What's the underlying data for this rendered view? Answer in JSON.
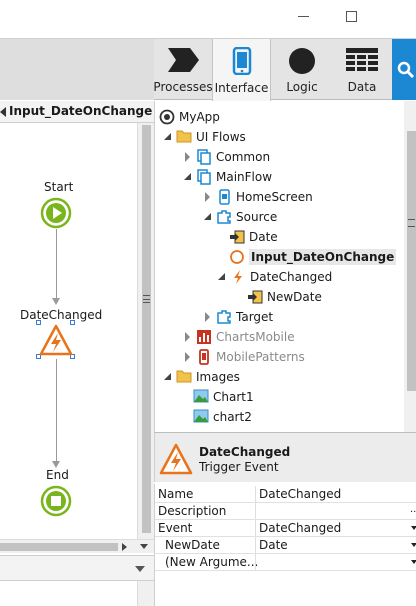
{
  "toolbar": {
    "tabs": [
      {
        "label": "Processes",
        "icon": "processes-icon"
      },
      {
        "label": "Interface",
        "icon": "interface-icon"
      },
      {
        "label": "Logic",
        "icon": "logic-icon"
      },
      {
        "label": "Data",
        "icon": "data-icon"
      }
    ],
    "search_icon": "search-icon"
  },
  "canvas": {
    "title": "Input_DateOnChange",
    "nodes": {
      "start": "Start",
      "trigger": "DateChanged",
      "end": "End"
    }
  },
  "tree": {
    "items": [
      {
        "label": "MyApp"
      },
      {
        "label": "UI Flows"
      },
      {
        "label": "Common"
      },
      {
        "label": "MainFlow"
      },
      {
        "label": "HomeScreen"
      },
      {
        "label": "Source"
      },
      {
        "label": "Date"
      },
      {
        "label": "Input_DateOnChange"
      },
      {
        "label": "DateChanged"
      },
      {
        "label": "NewDate"
      },
      {
        "label": "Target"
      },
      {
        "label": "ChartsMobile"
      },
      {
        "label": "MobilePatterns"
      },
      {
        "label": "Images"
      },
      {
        "label": "Chart1"
      },
      {
        "label": "chart2"
      }
    ]
  },
  "properties": {
    "title": "DateChanged",
    "subtitle": "Trigger Event",
    "rows": [
      {
        "key": "Name",
        "value": "DateChanged"
      },
      {
        "key": "Description",
        "value": ""
      },
      {
        "key": "Event",
        "value": "DateChanged"
      },
      {
        "key": "NewDate",
        "value": "Date"
      },
      {
        "key": "(New Argume...",
        "value": ""
      }
    ]
  },
  "colors": {
    "accent": "#1c88d4",
    "start_green": "#7ab51d",
    "trigger_orange": "#e8731a"
  }
}
